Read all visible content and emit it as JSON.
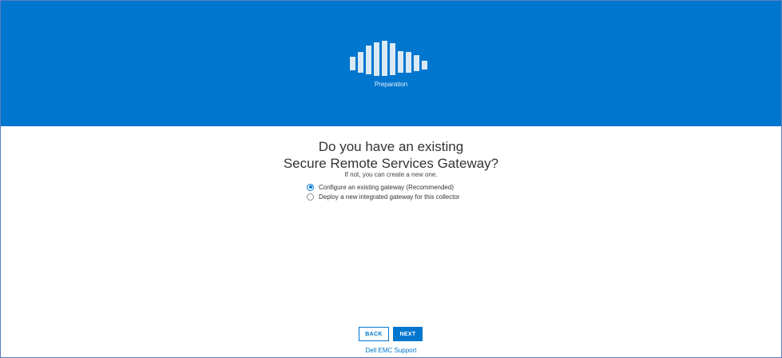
{
  "banner": {
    "step_label": "Preparation",
    "bar_levels": [
      0.38,
      0.6,
      0.82,
      0.96,
      1.0,
      0.9,
      0.62,
      0.6,
      0.46,
      0.26
    ],
    "background_color": "#0076ce"
  },
  "main": {
    "title_line1": "Do you have an existing",
    "title_line2": "Secure Remote Services Gateway?",
    "subtitle": "If not, you can create a new one.",
    "options": [
      {
        "label": "Configure an existing gateway (Recommended)",
        "selected": true
      },
      {
        "label": "Deploy a new integrated gateway for this collector",
        "selected": false
      }
    ]
  },
  "footer": {
    "back_label": "BACK",
    "next_label": "NEXT",
    "support_link": "Dell EMC Support"
  }
}
